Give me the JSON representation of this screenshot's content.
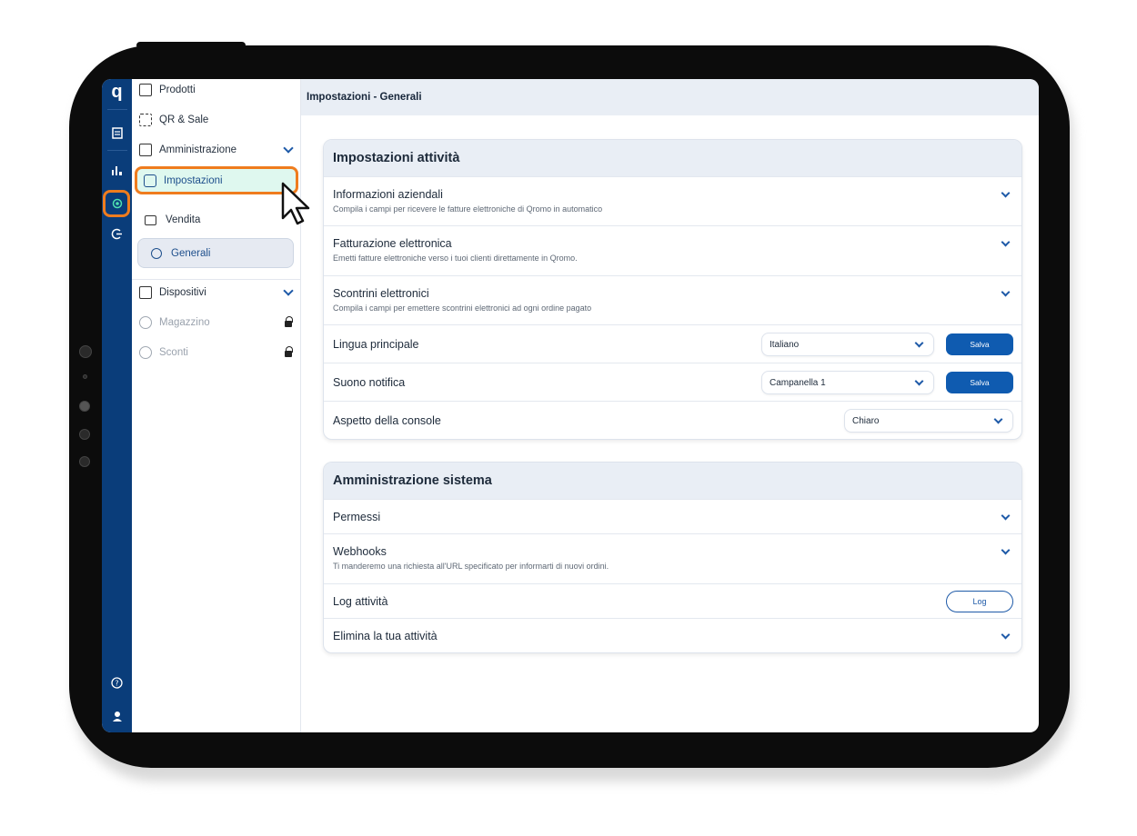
{
  "sidebar": {
    "prodotti": "Prodotti",
    "qr_sale": "QR & Sale",
    "amministrazione": "Amministrazione",
    "impostazioni": "Impostazioni",
    "vendita": "Vendita",
    "generali": "Generali",
    "dispositivi": "Dispositivi",
    "magazzino": "Magazzino",
    "sconti": "Sconti"
  },
  "rail": {
    "logo": "q",
    "help": "?"
  },
  "header": {
    "title": "Impostazioni - Generali"
  },
  "card1": {
    "title": "Impostazioni attività",
    "rows": [
      {
        "title": "Informazioni aziendali",
        "desc": "Compila i campi per ricevere le fatture elettroniche di Qromo in automatico"
      },
      {
        "title": "Fatturazione elettronica",
        "desc": "Emetti fatture elettroniche verso i tuoi clienti direttamente in Qromo."
      },
      {
        "title": "Scontrini elettronici",
        "desc": "Compila i campi per emettere scontrini elettronici ad ogni ordine pagato"
      }
    ],
    "lingua": {
      "label": "Lingua principale",
      "value": "Italiano",
      "button": "Salva"
    },
    "suono": {
      "label": "Suono notifica",
      "value": "Campanella 1",
      "button": "Salva"
    },
    "aspetto": {
      "label": "Aspetto della console",
      "value": "Chiaro"
    }
  },
  "card2": {
    "title": "Amministrazione sistema",
    "permessi": "Permessi",
    "webhooks": {
      "title": "Webhooks",
      "desc": "Ti manderemo una richiesta all'URL specificato per informarti di nuovi ordini."
    },
    "log": {
      "title": "Log attività",
      "button": "Log"
    },
    "elimina": "Elimina la tua attività"
  },
  "colors": {
    "accent": "#0f5bb0",
    "highlight": "#ef7c1e",
    "rail": "#0a3d7a",
    "active_bg": "#dff8ef"
  }
}
